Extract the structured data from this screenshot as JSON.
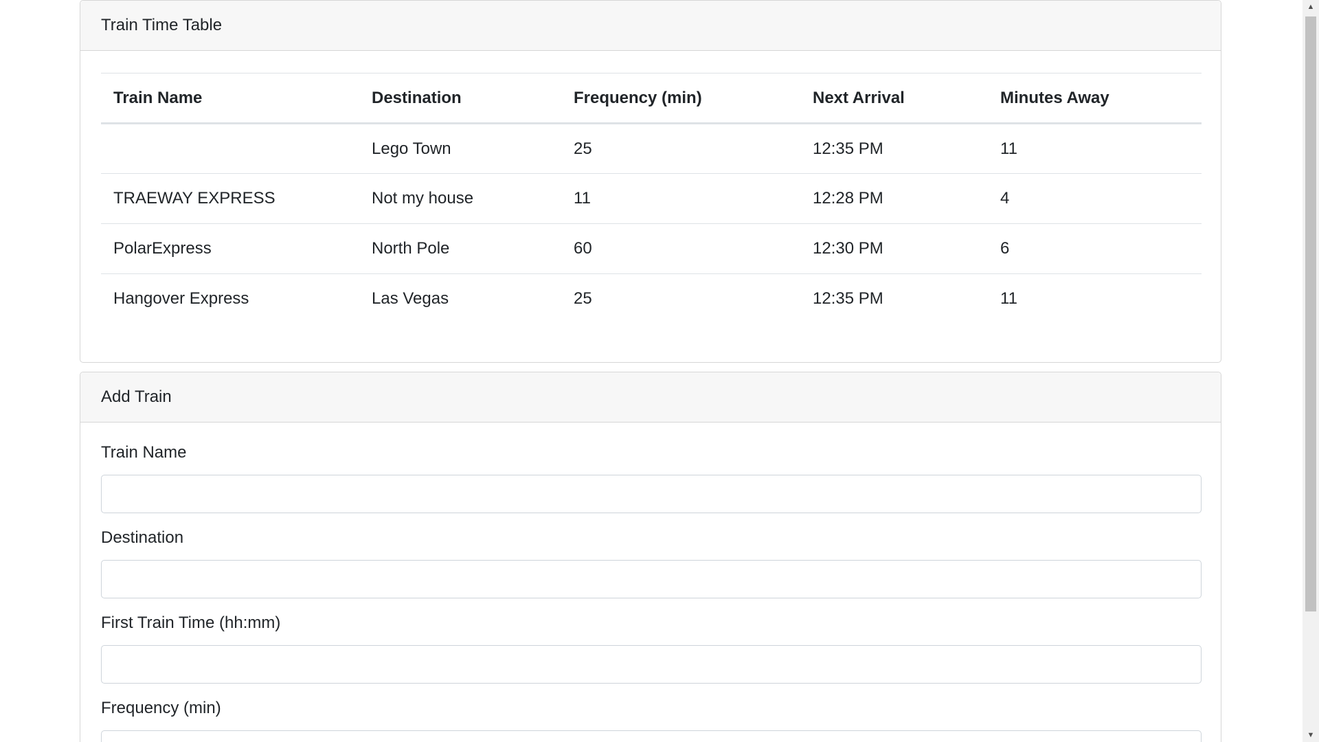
{
  "schedule": {
    "title": "Train Time Table",
    "columns": [
      "Train Name",
      "Destination",
      "Frequency (min)",
      "Next Arrival",
      "Minutes Away"
    ],
    "rows": [
      [
        "",
        "Lego Town",
        "25",
        "12:35 PM",
        "11"
      ],
      [
        "TRAEWAY EXPRESS",
        "Not my house",
        "11",
        "12:28 PM",
        "4"
      ],
      [
        "PolarExpress",
        "North Pole",
        "60",
        "12:30 PM",
        "6"
      ],
      [
        "Hangover Express",
        "Las Vegas",
        "25",
        "12:35 PM",
        "11"
      ]
    ]
  },
  "add_train": {
    "title": "Add Train",
    "fields": [
      {
        "label": "Train Name",
        "value": ""
      },
      {
        "label": "Destination",
        "value": ""
      },
      {
        "label": "First Train Time (hh:mm)",
        "value": ""
      },
      {
        "label": "Frequency (min)",
        "value": ""
      }
    ]
  },
  "scrollbar": {
    "up_icon": "triangle-up-icon",
    "down_icon": "triangle-down-icon"
  }
}
